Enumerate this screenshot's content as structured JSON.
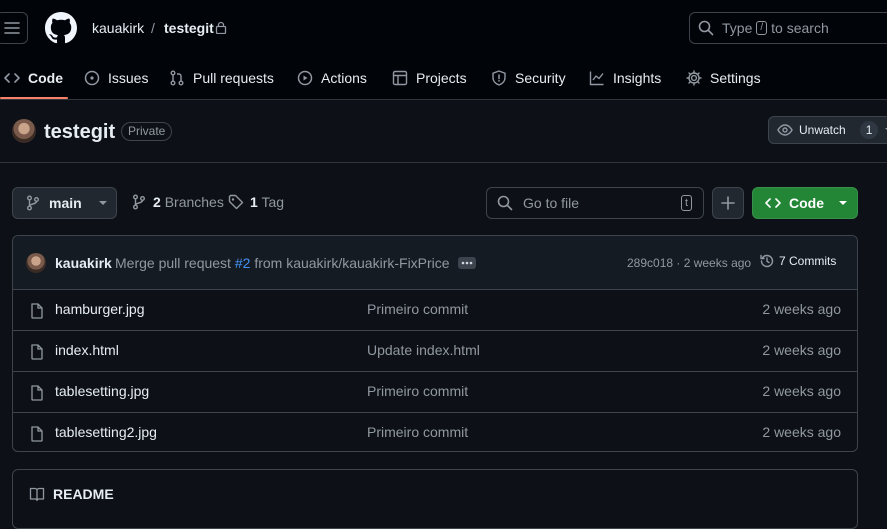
{
  "header": {
    "owner": "kauakirk",
    "separator": "/",
    "repo": "testegit",
    "search": {
      "pre": "Type",
      "key": "/",
      "post": "to search"
    }
  },
  "tabs": [
    {
      "label": "Code",
      "icon": "code-icon"
    },
    {
      "label": "Issues",
      "icon": "issue-icon"
    },
    {
      "label": "Pull requests",
      "icon": "pull-request-icon"
    },
    {
      "label": "Actions",
      "icon": "play-icon"
    },
    {
      "label": "Projects",
      "icon": "table-icon"
    },
    {
      "label": "Security",
      "icon": "shield-icon"
    },
    {
      "label": "Insights",
      "icon": "graph-icon"
    },
    {
      "label": "Settings",
      "icon": "gear-icon"
    }
  ],
  "repo_title": {
    "name": "testegit",
    "visibility": "Private",
    "unwatch_label": "Unwatch",
    "watch_count": "1"
  },
  "toolbar": {
    "branch": "main",
    "branches_count": "2",
    "branches_label": "Branches",
    "tags_count": "1",
    "tags_label": "Tag",
    "goto_placeholder": "Go to file",
    "goto_key": "t",
    "code_label": "Code"
  },
  "latest_commit": {
    "author": "kauakirk",
    "message_pre": "Merge pull request",
    "pr_link": "#2",
    "message_post": "from kauakirk/kauakirk-FixPrice",
    "hash_time": "289c018 · 2 weeks ago",
    "commits_label": "7 Commits"
  },
  "files": [
    {
      "name": "hamburger.jpg",
      "message": "Primeiro commit",
      "time": "2 weeks ago"
    },
    {
      "name": "index.html",
      "message": "Update index.html",
      "time": "2 weeks ago"
    },
    {
      "name": "tablesetting.jpg",
      "message": "Primeiro commit",
      "time": "2 weeks ago"
    },
    {
      "name": "tablesetting2.jpg",
      "message": "Primeiro commit",
      "time": "2 weeks ago"
    }
  ],
  "readme": {
    "label": "README"
  },
  "colors": {
    "accent_green": "#238636",
    "link_blue": "#4493f8",
    "tab_underline": "#f78166"
  }
}
